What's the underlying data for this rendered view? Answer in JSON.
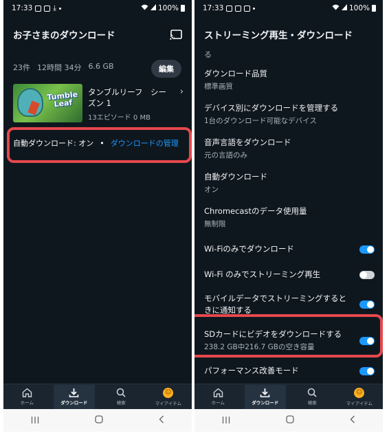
{
  "left": {
    "status": {
      "time": "17:33",
      "battery": "100%"
    },
    "title": "お子さまのダウンロード",
    "summary": {
      "count": "23件",
      "duration": "12時間 34分",
      "size": "6.6 GB"
    },
    "edit_label": "編集",
    "item": {
      "thumb_logo_line1": "Tumble",
      "thumb_logo_line2": "Leaf",
      "title": "タンブルリーフ　シーズン 1",
      "meta": "13エピソード  0 MB"
    },
    "auto_download": {
      "status": "自動ダウンロード: オン",
      "bullet": "•",
      "manage": "ダウンロードの管理"
    }
  },
  "right": {
    "status": {
      "time": "17:33",
      "battery": "100%"
    },
    "title": "ストリーミング再生・ダウンロード",
    "fragment": "る",
    "settings": [
      {
        "title": "ダウンロード品質",
        "sub": "標準画質"
      },
      {
        "title": "デバイス別にダウンロードを管理する",
        "sub": "1台のダウンロード可能なデバイス"
      },
      {
        "title": "音声言語をダウンロード",
        "sub": "元の言語のみ"
      },
      {
        "title": "自動ダウンロード",
        "sub": "オン"
      },
      {
        "title": "Chromecastのデータ使用量",
        "sub": "無制限"
      }
    ],
    "toggles": [
      {
        "title": "Wi-Fiのみでダウンロード",
        "on": true
      },
      {
        "title": "Wi-Fi のみでストリーミング再生",
        "on": false
      },
      {
        "title": "モバイルデータでストリーミングするときに通知する",
        "on": true
      },
      {
        "title": "SDカードにビデオをダウンロードする",
        "sub": "238.2 GB中216.7 GBの空き容量",
        "on": true
      },
      {
        "title": "パフォーマンス改善モード",
        "on": true
      }
    ]
  },
  "nav": {
    "home": "ホーム",
    "downloads": "ダウンロード",
    "search": "検索",
    "my_items": "マイアイテム"
  },
  "colors": {
    "background": "#0f171e",
    "accent": "#1a98ff",
    "highlight": "#e5484d"
  }
}
